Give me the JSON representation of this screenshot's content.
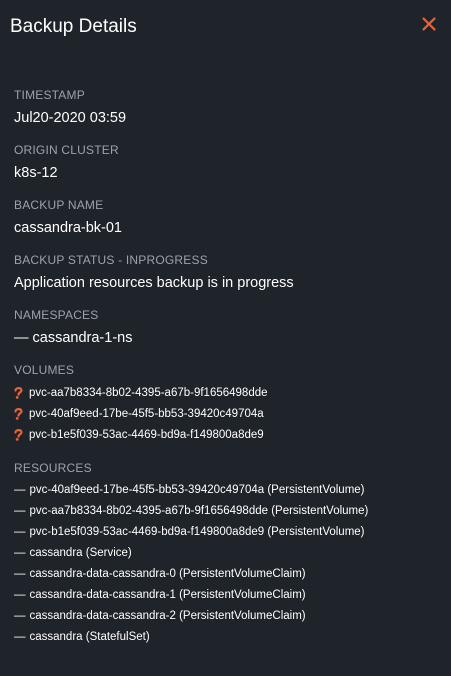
{
  "header": {
    "title": "Backup Details",
    "close_icon": "close-icon",
    "accent_color": "#e8633a"
  },
  "details": {
    "timestamp": {
      "label": "TIMESTAMP",
      "value": "Jul20-2020 03:59"
    },
    "origin_cluster": {
      "label": "ORIGIN CLUSTER",
      "value": "k8s-12"
    },
    "backup_name": {
      "label": "BACKUP NAME",
      "value": "cassandra-bk-01"
    },
    "backup_status": {
      "label": "BACKUP STATUS - INPROGRESS",
      "value": "Application resources backup is in progress"
    },
    "namespaces": {
      "label": "NAMESPACES",
      "items": [
        "— cassandra-1-ns"
      ]
    }
  },
  "volumes": {
    "label": "VOLUMES",
    "icon": "portworx-volume-icon",
    "items": [
      "pvc-aa7b8334-8b02-4395-a67b-9f1656498dde",
      "pvc-40af9eed-17be-45f5-bb53-39420c49704a",
      "pvc-b1e5f039-53ac-4469-bd9a-f149800a8de9"
    ]
  },
  "resources": {
    "label": "RESOURCES",
    "items": [
      "pvc-40af9eed-17be-45f5-bb53-39420c49704a (PersistentVolume)",
      "pvc-aa7b8334-8b02-4395-a67b-9f1656498dde (PersistentVolume)",
      "pvc-b1e5f039-53ac-4469-bd9a-f149800a8de9 (PersistentVolume)",
      "cassandra (Service)",
      "cassandra-data-cassandra-0 (PersistentVolumeClaim)",
      "cassandra-data-cassandra-1 (PersistentVolumeClaim)",
      "cassandra-data-cassandra-2 (PersistentVolumeClaim)",
      "cassandra (StatefulSet)"
    ]
  }
}
